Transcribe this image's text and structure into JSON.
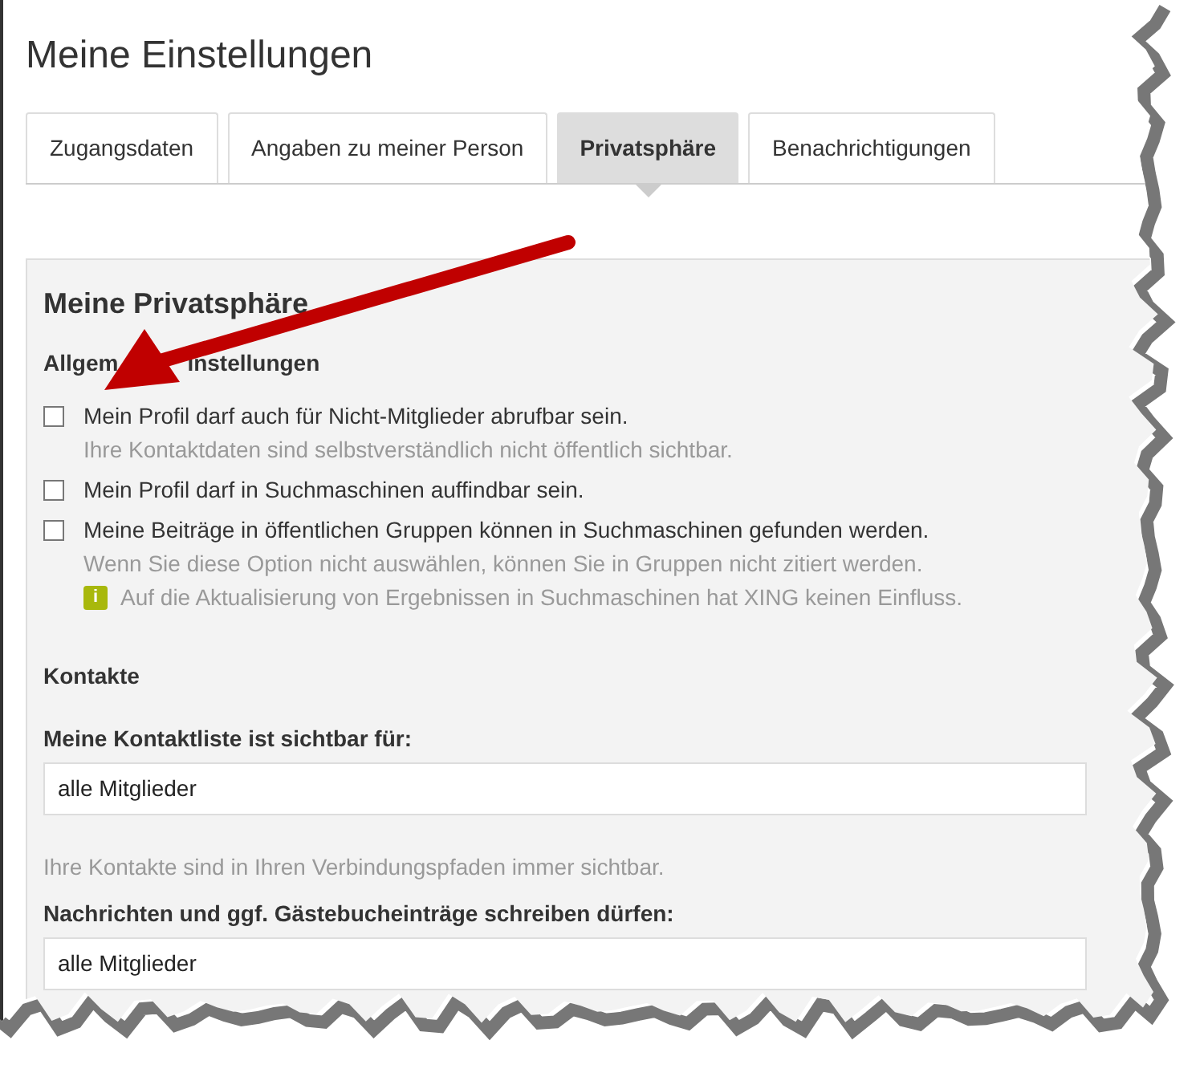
{
  "page_title": "Meine Einstellungen",
  "tabs": [
    {
      "label": "Zugangsdaten",
      "selected": false
    },
    {
      "label": "Angaben zu meiner Person",
      "selected": false
    },
    {
      "label": "Privatsphäre",
      "selected": true
    },
    {
      "label": "Benachrichtigungen",
      "selected": false
    }
  ],
  "panel": {
    "title": "Meine Privatsphäre",
    "general_heading_parts": [
      "Allgem",
      "instellungen"
    ],
    "options": [
      {
        "label": "Mein Profil darf auch für Nicht-Mitglieder abrufbar sein.",
        "checked": false,
        "hints": [
          "Ihre Kontaktdaten sind selbstverständlich nicht öffentlich sichtbar."
        ]
      },
      {
        "label": "Mein Profil darf in Suchmaschinen auffindbar sein.",
        "checked": false
      },
      {
        "label": "Meine Beiträge in öffentlichen Gruppen können in Suchmaschinen gefunden werden.",
        "checked": false,
        "hints": [
          "Wenn Sie diese Option nicht auswählen, können Sie in Gruppen nicht zitiert werden."
        ],
        "info": {
          "icon_text": "i",
          "text": "Auf die Aktualisierung von Ergebnissen in Suchmaschinen hat XING keinen Einfluss."
        }
      }
    ],
    "contacts_heading": "Kontakte",
    "fields": [
      {
        "label": "Meine Kontaktliste ist sichtbar für:",
        "value": "alle Mitglieder",
        "note": "Ihre Kontakte sind in Ihren Verbindungspfaden immer sichtbar."
      },
      {
        "label": "Nachrichten und ggf. Gästebucheinträge schreiben dürfen:",
        "value": "alle Mitglieder"
      }
    ]
  }
}
